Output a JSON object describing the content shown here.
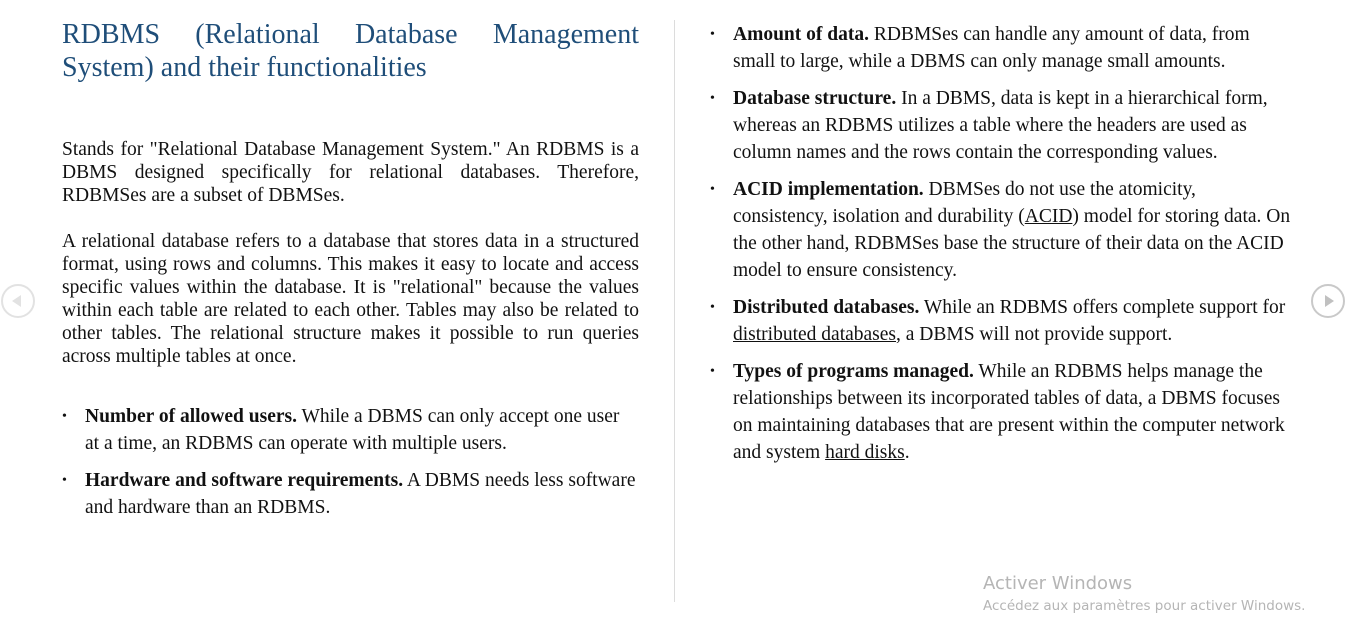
{
  "title": "RDBMS (Relational Database Management System) and their functionalities",
  "intro_paragraphs": [
    "Stands for \"Relational Database Management System.\" An RDBMS is a DBMS designed specifically for relational databases. Therefore, RDBMSes are a subset of DBMSes.",
    "A relational database refers to a database that stores data in a structured format, using rows and columns. This makes it easy to locate and access specific values within the database. It is \"relational\" because the values within each table are related to each other. Tables may also be related to other tables. The relational structure makes it possible to run queries across multiple tables at once."
  ],
  "bullets_left": [
    {
      "term": "Number of allowed users.",
      "text": " While a DBMS can only accept one user at a time, an RDBMS can operate with multiple users."
    },
    {
      "term": "Hardware and software requirements.",
      "text": " A DBMS needs less software and hardware than an RDBMS."
    }
  ],
  "bullets_right": [
    {
      "term": "Amount of data.",
      "text": " RDBMSes can handle any amount of data, from small to large, while a DBMS can only manage small amounts."
    },
    {
      "term": "Database structure.",
      "text": " In a DBMS, data is kept in a hierarchical form, whereas an RDBMS utilizes a table where the headers are used as column names and the rows contain the corresponding values."
    },
    {
      "term": "ACID implementation.",
      "text_before": " DBMSes do not use the atomicity, consistency, isolation and durability (",
      "link": "ACID",
      "text_after": ") model for storing data. On the other hand, RDBMSes base the structure of their data on the ACID model to ensure consistency."
    },
    {
      "term": "Distributed databases.",
      "text_before": " While an RDBMS offers complete support for ",
      "link": "distributed databases",
      "text_after": ", a DBMS will not provide support."
    },
    {
      "term": "Types of programs managed.",
      "text_before": " While an RDBMS helps manage the relationships between its incorporated tables of data, a DBMS focuses on maintaining databases that are present within the computer network and system ",
      "link": "hard disks",
      "text_after": "."
    }
  ],
  "bullet_char": "•",
  "watermark": {
    "title": "Activer Windows",
    "subtitle": "Accédez aux paramètres pour activer Windows."
  },
  "nav": {
    "prev_icon": "chevron-left-circle-icon",
    "next_icon": "chevron-right-circle-icon"
  },
  "colors": {
    "title": "#1f4e79",
    "text": "#111111",
    "watermark": "#b5b5b5"
  }
}
